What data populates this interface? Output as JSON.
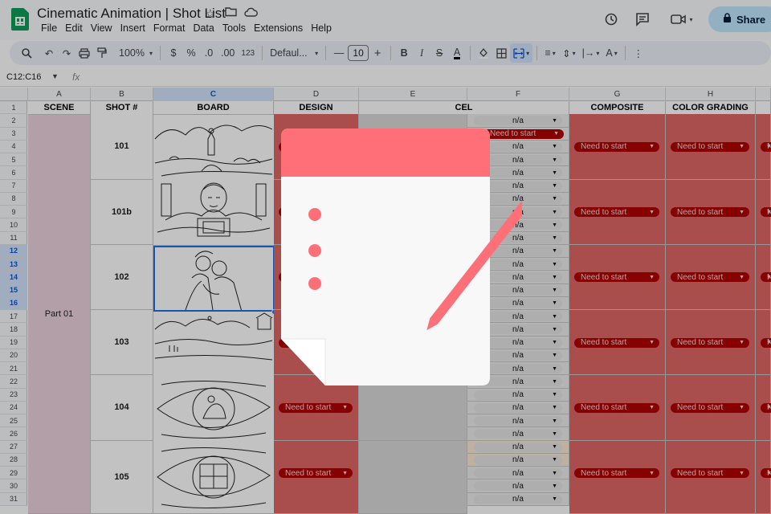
{
  "app": {
    "doc_title": "Cinematic Animation | Shot List",
    "menu": [
      "File",
      "Edit",
      "View",
      "Insert",
      "Format",
      "Data",
      "Tools",
      "Extensions",
      "Help"
    ],
    "share_label": "Share"
  },
  "toolbar": {
    "zoom": "100%",
    "currency": "$",
    "percent": "%",
    "dec_decrease": ".0",
    "dec_increase": ".00",
    "number_format": "123",
    "font": "Defaul...",
    "font_size": "10",
    "bold": "B",
    "italic": "I"
  },
  "formula_bar": {
    "name_box": "C12:C16",
    "fx": "fx",
    "value": ""
  },
  "columns": [
    "A",
    "B",
    "C",
    "D",
    "E",
    "F",
    "G",
    "H"
  ],
  "headers": {
    "scene": "SCENE",
    "shot": "SHOT #",
    "board": "BOARD",
    "design": "DESIGN",
    "cel": "CEL",
    "composite": "COMPOSITE",
    "color_grading": "COLOR GRADING"
  },
  "rows": [
    "1",
    "2",
    "3",
    "4",
    "5",
    "6",
    "7",
    "8",
    "9",
    "10",
    "11",
    "12",
    "13",
    "14",
    "15",
    "16",
    "17",
    "18",
    "19",
    "20",
    "21",
    "22",
    "23",
    "24",
    "25",
    "26",
    "27",
    "28",
    "29",
    "30",
    "31"
  ],
  "scene_label": "Part 01",
  "shots": [
    "101",
    "101b",
    "102",
    "103",
    "104",
    "105"
  ],
  "status": {
    "na": "n/a",
    "need": "Need to start"
  },
  "colors": {
    "scene_fill": "#ead1dc",
    "status_fill": "#e06666",
    "chip_red": "#b10202",
    "selection": "#1a73e8",
    "note_pink": "#ff6f78",
    "overlay": "rgba(0,0,0,0.24)"
  }
}
